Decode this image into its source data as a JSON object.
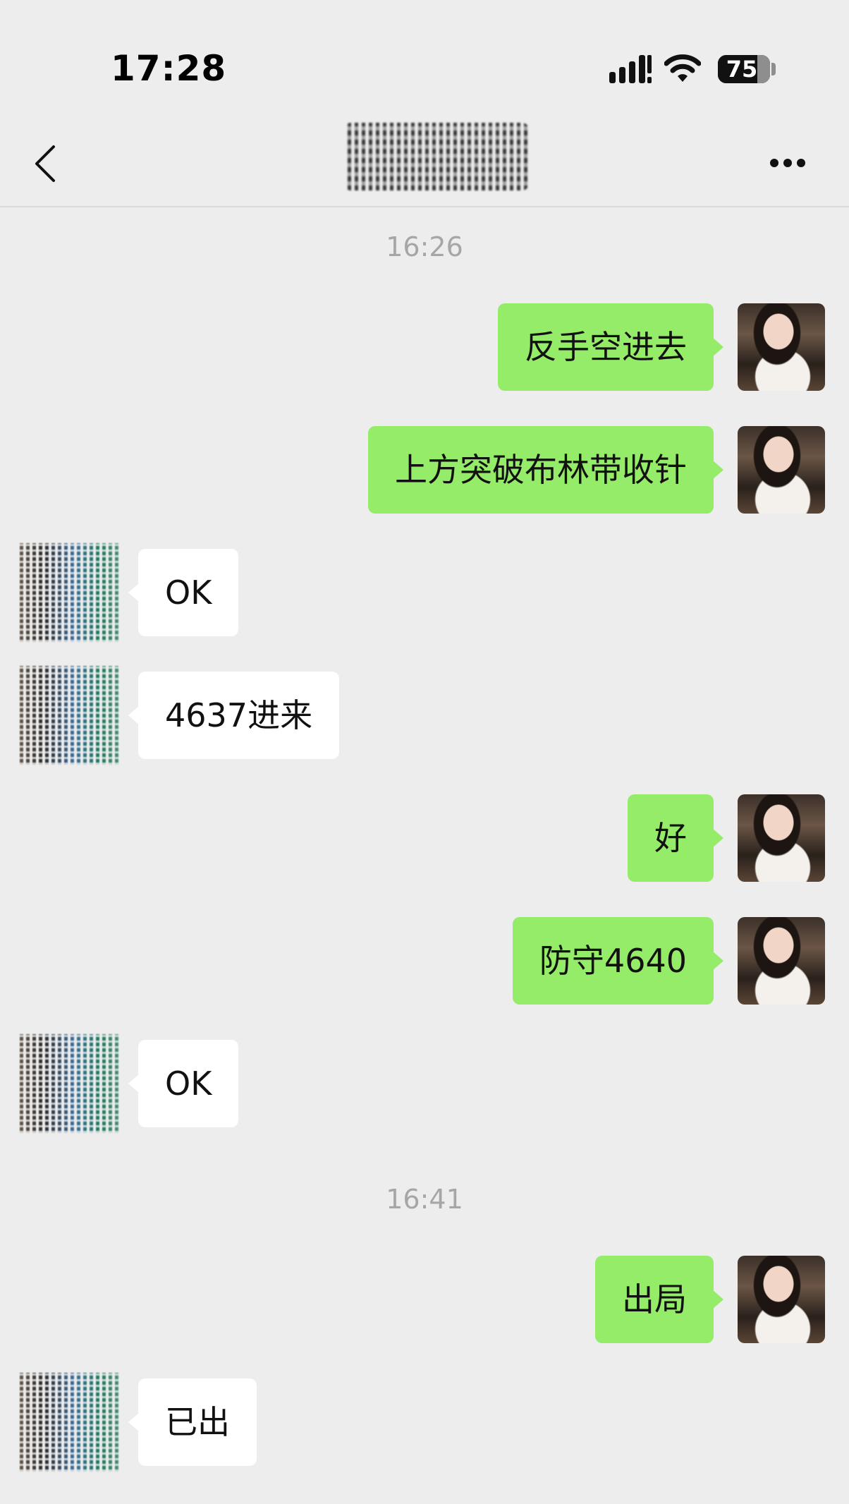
{
  "status_bar": {
    "time": "17:28",
    "battery": "75",
    "battery_level": 0.75,
    "icons": [
      "signal-icon",
      "wifi-icon",
      "battery-icon"
    ]
  },
  "nav": {
    "title": "",
    "icons": [
      "back-chevron-icon",
      "more-icon"
    ]
  },
  "chat": {
    "timestamps": [
      "16:26",
      "16:41"
    ],
    "messages": [
      {
        "sender": "me",
        "text": "反手空进去"
      },
      {
        "sender": "me",
        "text": "上方突破布林带收针"
      },
      {
        "sender": "them",
        "text": "OK"
      },
      {
        "sender": "them",
        "text": "4637进来"
      },
      {
        "sender": "me",
        "text": "好"
      },
      {
        "sender": "me",
        "text": "防守4640"
      },
      {
        "sender": "them",
        "text": "OK"
      },
      {
        "sender": "me",
        "text": "出局"
      },
      {
        "sender": "them",
        "text": "已出"
      }
    ]
  },
  "colors": {
    "background": "#ededed",
    "my_bubble": "#95ec69",
    "their_bubble": "#ffffff",
    "timestamp": "#a6a6a6"
  }
}
